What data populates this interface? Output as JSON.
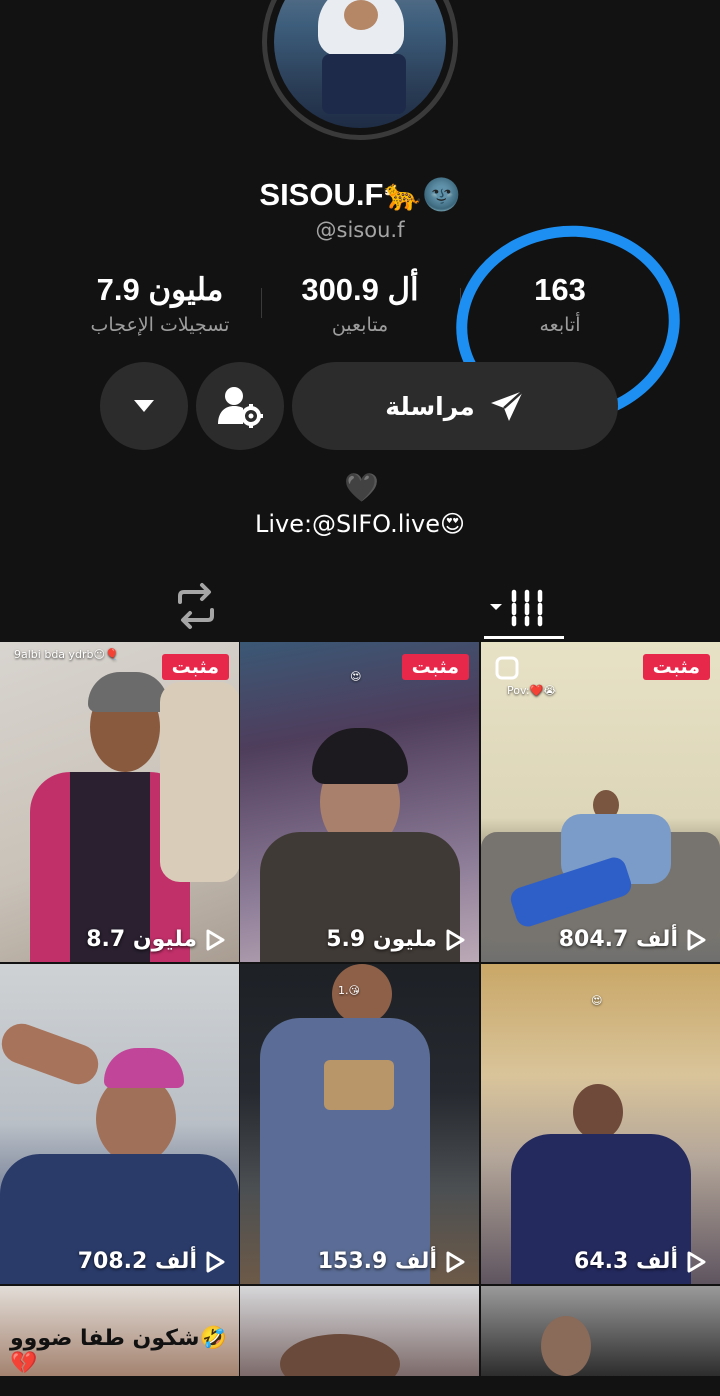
{
  "profile": {
    "username": "SISOU.F🐆🌚",
    "handle": "@sisou.f",
    "bio_heart": "🖤",
    "bio": "Live:@SIFO.live😍"
  },
  "stats": {
    "likes": {
      "value": "7.9 مليون",
      "label": "تسجيلات الإعجاب"
    },
    "followers": {
      "value": "300.9 أل",
      "label": "متابعين"
    },
    "following": {
      "value": "163",
      "label": "أتابعه"
    }
  },
  "buttons": {
    "message_label": "مراسلة"
  },
  "annotation_color": "#1d8ff2",
  "grid": {
    "pinned_label": "مثبت",
    "tiles": [
      {
        "views": "8.7 مليون",
        "pinned": true,
        "caption": "9albi bda ydrb😶🎈"
      },
      {
        "views": "5.9 مليون",
        "pinned": true,
        "caption": "😍"
      },
      {
        "views": "804.7 ألف",
        "pinned": true,
        "caption": "Pov:❤️😭"
      },
      {
        "views": "708.2 ألف",
        "pinned": false,
        "caption": ""
      },
      {
        "views": "153.9 ألف",
        "pinned": false,
        "caption": "1.😘"
      },
      {
        "views": "64.3 ألف",
        "pinned": false,
        "caption": "😍"
      },
      {
        "caption": "شكون طفا ضووو🤣💔"
      },
      {
        "caption": ""
      },
      {
        "caption": ""
      }
    ]
  }
}
